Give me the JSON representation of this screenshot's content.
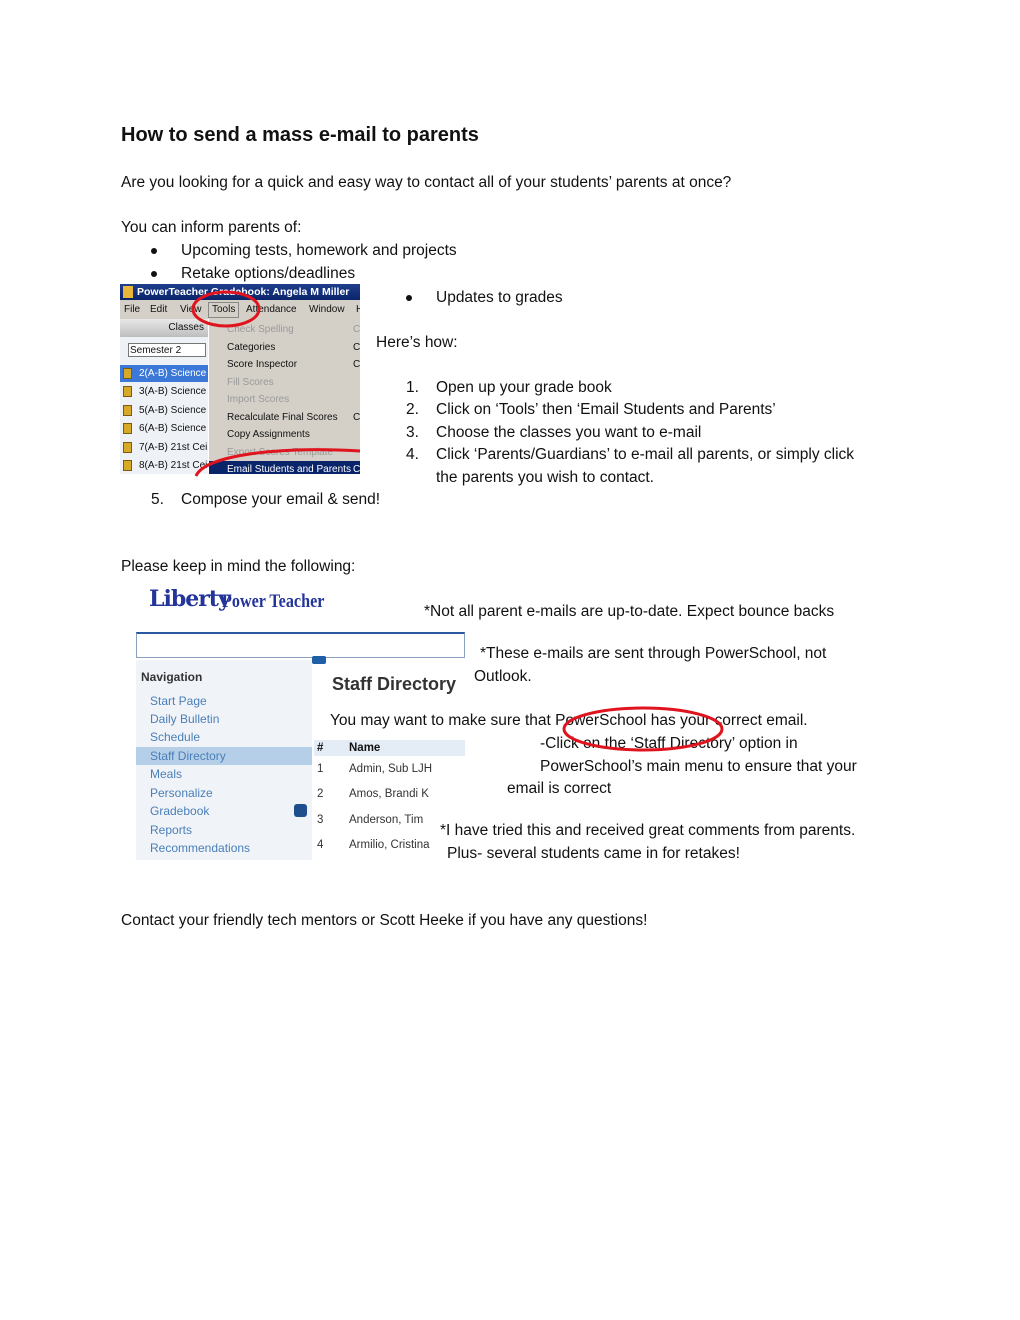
{
  "title": "How to send a mass e-mail to parents",
  "intro": "Are you looking for a quick and easy way to contact all of your students’ parents at once?",
  "inform_label": "You can inform parents of:",
  "inform_items": [
    "Upcoming tests, homework and projects",
    "Retake options/deadlines",
    "Updates to grades"
  ],
  "how_label": "Here’s how:",
  "steps": [
    {
      "num": "1.",
      "text": "Open up your grade book"
    },
    {
      "num": "2.",
      "text": "Click on ‘Tools’ then ‘Email Students and Parents’"
    },
    {
      "num": "3.",
      "text": "Choose the classes you want to e-mail"
    },
    {
      "num": "4.",
      "text": "Click ‘Parents/Guardians’ to e-mail all parents, or simply click",
      "text2": "the parents you wish to contact."
    },
    {
      "num": "5.",
      "text": "Compose your email & send!"
    }
  ],
  "keep_in_mind": "Please keep in mind the following:",
  "notes": {
    "n1": "*Not all parent e-mails are up-to-date. Expect bounce backs",
    "n2a": "*These e-mails are sent through PowerSchool, not",
    "n2b": "Outlook.",
    "n3a": "You may want to make sure that PowerSchool has your correct email.",
    "n3b": "-Click on the ‘Staff Directory’ option in",
    "n3c": "PowerSchool’s main menu to ensure that your",
    "n3d": "email is correct",
    "n4a": "*I have tried this and received great comments from parents.",
    "n4b": "Plus- several students came in for retakes!"
  },
  "contact": "Contact your friendly tech mentors or Scott Heeke if you have any questions!",
  "gradebook_screenshot": {
    "window_title": "PowerTeacher Gradebook: Angela M Miller",
    "menubar": [
      "File",
      "Edit",
      "View",
      "Tools",
      "Attendance",
      "Window",
      "H"
    ],
    "classes_header": "Classes",
    "term": "Semester 2",
    "classes": [
      "2(A-B) Science",
      "3(A-B) Science",
      "5(A-B) Science",
      "6(A-B) Science",
      "7(A-B) 21st Cei",
      "8(A-B) 21st Cei"
    ],
    "tools_menu": [
      {
        "label": "Check Spelling",
        "shortcut": "Ct",
        "disabled": true
      },
      {
        "label": "Categories",
        "shortcut": "Ct",
        "disabled": false
      },
      {
        "label": "Score Inspector",
        "shortcut": "Ct",
        "disabled": false
      },
      {
        "label": "Fill Scores",
        "shortcut": "",
        "disabled": true
      },
      {
        "label": "Import Scores",
        "shortcut": "",
        "disabled": true
      },
      {
        "label": "Recalculate Final Scores",
        "shortcut": "Ct",
        "disabled": false
      },
      {
        "label": "Copy Assignments",
        "shortcut": "",
        "disabled": false
      },
      {
        "label": "Export Scores Template",
        "shortcut": "",
        "disabled": true
      },
      {
        "label": "Email Students and Parents",
        "shortcut": "Ct",
        "disabled": false
      }
    ]
  },
  "powerschool_screenshot": {
    "logo": "Liberty",
    "logo_product": "Power Teacher",
    "nav_header": "Navigation",
    "nav_items": [
      "Start Page",
      "Daily Bulletin",
      "Schedule",
      "Staff Directory",
      "Meals",
      "Personalize",
      "Gradebook",
      "Reports",
      "Recommendations"
    ],
    "selected_nav": "Staff Directory",
    "page_title": "Staff Directory",
    "table_headers": [
      "#",
      "Name"
    ],
    "rows": [
      [
        "1",
        "Admin, Sub LJH"
      ],
      [
        "2",
        "Amos, Brandi K"
      ],
      [
        "3",
        "Anderson, Tim"
      ],
      [
        "4",
        "Armilio, Cristina"
      ]
    ]
  },
  "colors": {
    "annotation_red": "#e0141e",
    "title_bar": "#0a246a",
    "nav_link": "#4a7fb8"
  }
}
